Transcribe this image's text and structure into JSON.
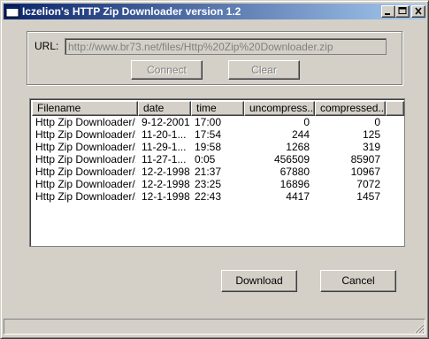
{
  "window": {
    "title": "Iczelion's HTTP Zip Downloader version 1.2",
    "controls": [
      "minimize-icon",
      "maximize-icon",
      "close-icon"
    ]
  },
  "url_section": {
    "label": "URL:",
    "value": "http://www.br73.net/files/Http%20Zip%20Downloader.zip",
    "connect_label": "Connect",
    "clear_label": "Clear"
  },
  "list": {
    "columns": [
      "Filename",
      "date",
      "time",
      "uncompress...",
      "compressed..."
    ],
    "rows": [
      [
        "Http Zip Downloader/",
        "9-12-2001",
        "17:00",
        "0",
        "0"
      ],
      [
        "Http Zip Downloader/...",
        "11-20-1...",
        "17:54",
        "244",
        "125"
      ],
      [
        "Http Zip Downloader/...",
        "11-29-1...",
        "19:58",
        "1268",
        "319"
      ],
      [
        "Http Zip Downloader/...",
        "11-27-1...",
        "0:05",
        "456509",
        "85907"
      ],
      [
        "Http Zip Downloader/...",
        "12-2-1998",
        "21:37",
        "67880",
        "10967"
      ],
      [
        "Http Zip Downloader/...",
        "12-2-1998",
        "23:25",
        "16896",
        "7072"
      ],
      [
        "Http Zip Downloader/...",
        "12-1-1998",
        "22:43",
        "4417",
        "1457"
      ]
    ]
  },
  "actions": {
    "download_label": "Download",
    "cancel_label": "Cancel"
  },
  "status": {
    "text": ""
  }
}
